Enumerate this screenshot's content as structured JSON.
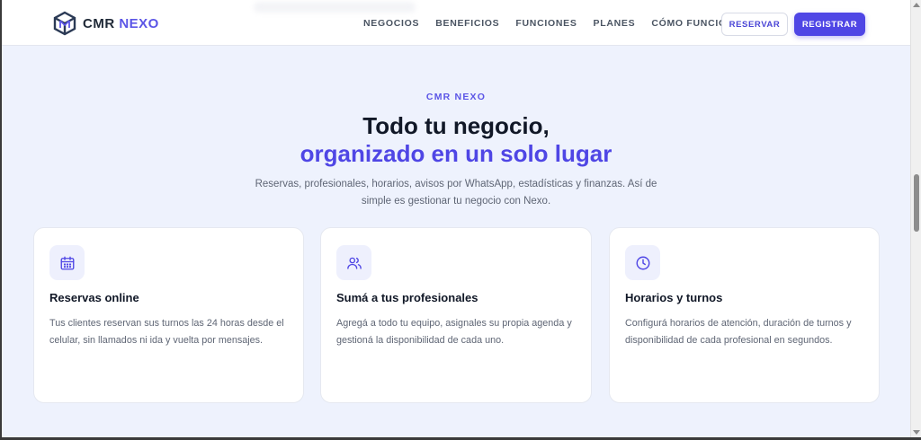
{
  "brand": {
    "name_part1": "CMR",
    "name_part2": "NEXO"
  },
  "nav": {
    "items": [
      "NEGOCIOS",
      "BENEFICIOS",
      "FUNCIONES",
      "PLANES",
      "CÓMO FUNCIONA"
    ],
    "reserve_label": "RESERVAR",
    "register_label": "REGISTRAR"
  },
  "hero": {
    "eyebrow": "CMR NEXO",
    "title_line1": "Todo tu negocio,",
    "title_line2": "organizado en un solo lugar",
    "subtitle": "Reservas, profesionales, horarios, avisos por WhatsApp, estadísticas y finanzas. Así de simple es gestionar tu negocio con Nexo."
  },
  "features": [
    {
      "icon": "calendar-icon",
      "title": "Reservas online",
      "description": "Tus clientes reservan sus turnos las 24 horas desde el celular, sin llamados ni ida y vuelta por mensajes."
    },
    {
      "icon": "users-icon",
      "title": "Sumá a tus profesionales",
      "description": "Agregá a todo tu equipo, asignales su propia agenda y gestioná la disponibilidad de cada uno."
    },
    {
      "icon": "clock-icon",
      "title": "Horarios y turnos",
      "description": "Configurá horarios de atención, duración de turnos y disponibilidad de cada profesional en segundos."
    }
  ],
  "colors": {
    "accent": "#4f46e5",
    "background": "#eef2fd",
    "text_dark": "#111827",
    "text_muted": "#5f6675"
  }
}
